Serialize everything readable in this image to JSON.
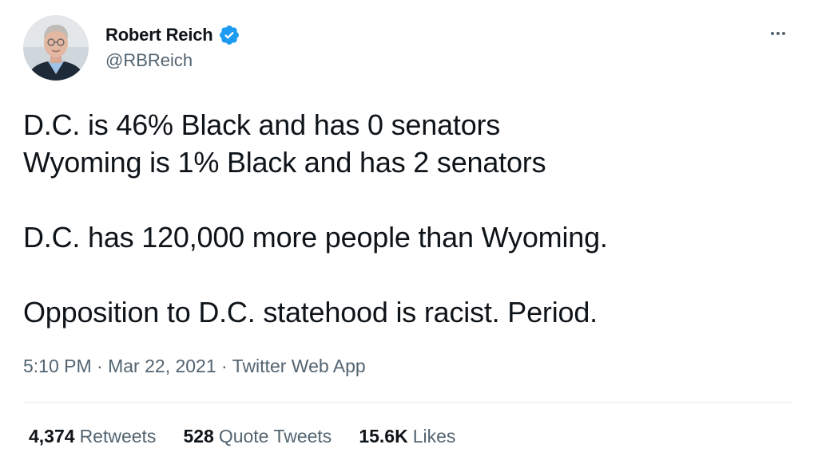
{
  "author": {
    "display_name": "Robert Reich",
    "handle": "@RBReich",
    "verified": true,
    "avatar_icon": "person-photo-avatar"
  },
  "tweet": {
    "lines": [
      "D.C. is 46% Black and has 0 senators",
      "Wyoming is 1% Black and has 2 senators",
      "D.C. has 120,000 more people than Wyoming.",
      "Opposition to D.C. statehood is racist. Period."
    ],
    "time": "5:10 PM",
    "date": "Mar 22, 2021",
    "source": "Twitter Web App",
    "separator": " · "
  },
  "stats": {
    "retweets_count": "4,374",
    "retweets_label": "Retweets",
    "quotes_count": "528",
    "quotes_label": "Quote Tweets",
    "likes_count": "15.6K",
    "likes_label": "Likes"
  },
  "colors": {
    "text": "#0f1419",
    "secondary": "#536471",
    "verified_blue": "#1d9bf0",
    "divider": "#e7ebee"
  }
}
